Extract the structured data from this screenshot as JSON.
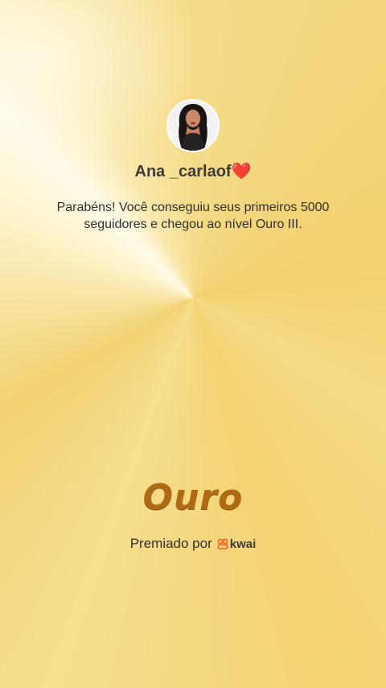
{
  "user": {
    "name": "Ana _carlaof",
    "name_emoji": "❤️"
  },
  "message": "Parabéns! Você conseguiu seus primeiros 5000 seguidores e chegou ao nível Ouro III.",
  "level": {
    "label": "Ouro"
  },
  "footer": {
    "awarded_by": "Premiado por",
    "brand": "kwai",
    "brand_icon": "kwai-logo-icon"
  },
  "colors": {
    "background": "#f4d77e",
    "level_text": "#b06a14",
    "brand_orange": "#ff5a1f",
    "heart": "#e0333b"
  }
}
